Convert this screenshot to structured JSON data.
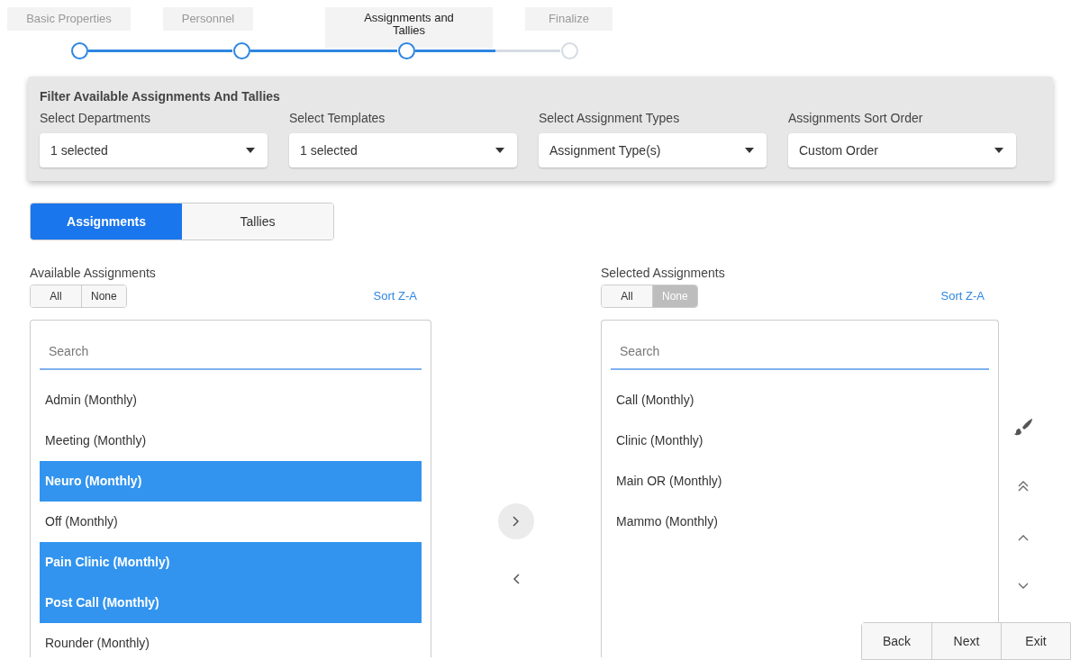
{
  "stepper": [
    {
      "label": "Basic Properties",
      "completed": true,
      "selected": false
    },
    {
      "label": "Personnel",
      "completed": true,
      "selected": false
    },
    {
      "label": "Assignments and Tallies",
      "completed": false,
      "selected": true
    },
    {
      "label": "Finalize",
      "completed": false,
      "selected": false
    }
  ],
  "filter_panel": {
    "title": "Filter Available Assignments And Tallies",
    "filters": [
      {
        "label": "Select Departments",
        "value": "1 selected"
      },
      {
        "label": "Select Templates",
        "value": "1 selected"
      },
      {
        "label": "Select Assignment Types",
        "value": "Assignment Type(s)"
      },
      {
        "label": "Assignments Sort Order",
        "value": "Custom Order"
      }
    ]
  },
  "tabs": [
    {
      "label": "Assignments",
      "selected": true
    },
    {
      "label": "Tallies",
      "selected": false
    }
  ],
  "available": {
    "title": "Available Assignments",
    "toggle": [
      {
        "label": "All",
        "selected": false
      },
      {
        "label": "None",
        "selected": false
      }
    ],
    "sort_link": "Sort Z-A",
    "search": {
      "placeholder": "Search"
    },
    "items": [
      {
        "label": "Admin (Monthly)",
        "selected": false
      },
      {
        "label": "Meeting (Monthly)",
        "selected": false
      },
      {
        "label": "Neuro (Monthly)",
        "selected": true
      },
      {
        "label": "Off (Monthly)",
        "selected": false
      },
      {
        "label": "Pain Clinic (Monthly)",
        "selected": true
      },
      {
        "label": "Post Call (Monthly)",
        "selected": true
      },
      {
        "label": "Rounder (Monthly)",
        "selected": false
      }
    ]
  },
  "selected": {
    "title": "Selected Assignments",
    "toggle": [
      {
        "label": "All",
        "selected": false
      },
      {
        "label": "None",
        "selected": true
      }
    ],
    "sort_link": "Sort Z-A",
    "search": {
      "placeholder": "Search"
    },
    "items": [
      {
        "label": "Call (Monthly)",
        "selected": false
      },
      {
        "label": "Clinic (Monthly)",
        "selected": false
      },
      {
        "label": "Main OR (Monthly)",
        "selected": false
      },
      {
        "label": "Mammo (Monthly)",
        "selected": false
      }
    ]
  },
  "footer_buttons": [
    "Back",
    "Next",
    "Exit"
  ]
}
